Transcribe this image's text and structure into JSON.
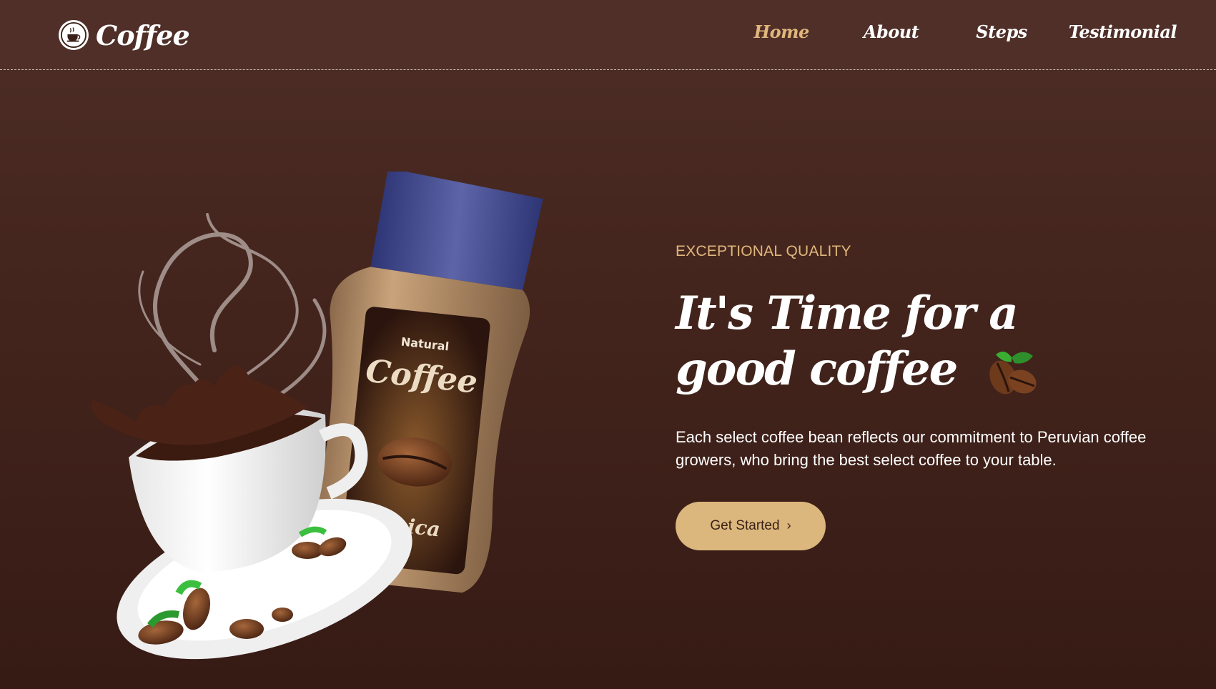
{
  "brand": {
    "name": "Coffee",
    "logo_icon": "coffee-cup-icon"
  },
  "nav": {
    "items": [
      {
        "label": "Home",
        "active": true
      },
      {
        "label": "About",
        "active": false
      },
      {
        "label": "Steps",
        "active": false
      },
      {
        "label": "Testimonial",
        "active": false
      }
    ]
  },
  "hero": {
    "eyebrow": "EXCEPTIONAL QUALITY",
    "headline": "It's Time for a good coffee",
    "headline_icon": "coffee-beans-icon",
    "description": "Each select coffee bean reflects our commitment to Peruvian coffee growers, who bring the best select coffee to your table.",
    "cta_label": "Get Started",
    "cta_icon": "chevron-right-icon",
    "jar_label": {
      "top": "Natural",
      "main": "Coffee",
      "bottom": "Arabica"
    }
  },
  "colors": {
    "accent": "#e0b77c",
    "button": "#dbb77d",
    "header_bg": "#4f2f28",
    "body_bg": "#3d2019"
  }
}
